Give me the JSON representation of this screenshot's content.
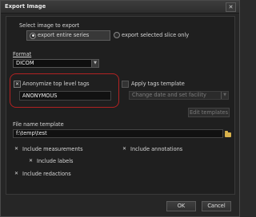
{
  "window": {
    "title": "Export Image"
  },
  "select_image": {
    "label": "Select image to export",
    "option_entire": "export entire series",
    "option_slice": "export selected slice only"
  },
  "format": {
    "label": "Format",
    "value": "DICOM"
  },
  "anonymize": {
    "label": "Anonymize top level tags",
    "value": "ANONYMOUS",
    "checked": true
  },
  "tags_template": {
    "label": "Apply tags template",
    "value": "Change date and set facility",
    "edit_button": "Edit templates",
    "checked": false
  },
  "file_name": {
    "label": "File name template",
    "value": "f:\\temp\\test"
  },
  "includes": {
    "measurements": "Include measurements",
    "annotations": "Include annotations",
    "labels": "Include labels",
    "redactions": "Include redactions"
  },
  "buttons": {
    "ok": "OK",
    "cancel": "Cancel"
  },
  "colors": {
    "highlight_outline": "#b22222",
    "background": "#262626"
  }
}
